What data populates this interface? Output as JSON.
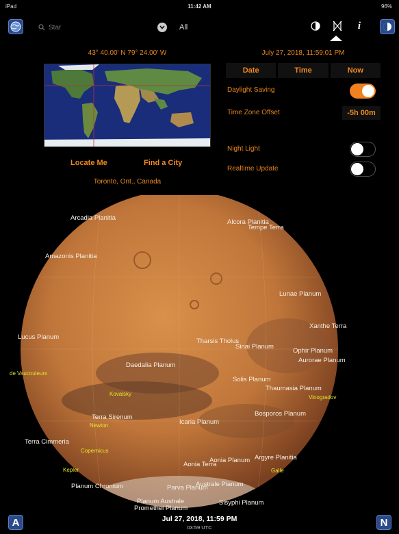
{
  "status": {
    "device": "iPad",
    "time": "11:42 AM",
    "battery": "96%"
  },
  "search": {
    "placeholder": "Star"
  },
  "filter": {
    "label": "All"
  },
  "location": {
    "coordinates": "43° 40.00' N 79° 24.00' W",
    "locate_me": "Locate Me",
    "find_city": "Find a City",
    "place": "Toronto, Ont., Canada"
  },
  "datetime": {
    "current": "July 27, 2018, 11:59:01 PM",
    "seg": [
      "Date",
      "Time",
      "Now"
    ]
  },
  "settings": {
    "daylight_saving": "Daylight Saving",
    "daylight_saving_on": true,
    "tz_offset_label": "Time Zone Offset",
    "tz_offset_value": "-5h 00m",
    "night_light": "Night Light",
    "night_light_on": false,
    "realtime_update": "Realtime Update",
    "realtime_update_on": false
  },
  "mars_labels": [
    {
      "text": "Arcadia Planitia",
      "type": "region"
    },
    {
      "text": "Alcora Planitia",
      "type": "region"
    },
    {
      "text": "Tempe Terra",
      "type": "region"
    },
    {
      "text": "Amazonis Planitia",
      "type": "region"
    },
    {
      "text": "Lunae Planum",
      "type": "region"
    },
    {
      "text": "Xanthe Terra",
      "type": "region"
    },
    {
      "text": "Lucus Planum",
      "type": "region"
    },
    {
      "text": "Tharsis Tholus",
      "type": "region"
    },
    {
      "text": "Sinai Planum",
      "type": "region"
    },
    {
      "text": "Ophir Planum",
      "type": "region"
    },
    {
      "text": "Aurorae Planum",
      "type": "region"
    },
    {
      "text": "de Vaucouleurs",
      "type": "crater"
    },
    {
      "text": "Daedalia Planum",
      "type": "region"
    },
    {
      "text": "Solis Planum",
      "type": "region"
    },
    {
      "text": "Thaumasia Planum",
      "type": "region"
    },
    {
      "text": "Vinogradov",
      "type": "crater"
    },
    {
      "text": "Kovalsky",
      "type": "crater"
    },
    {
      "text": "Terra Sirenum",
      "type": "region"
    },
    {
      "text": "Icaria Planum",
      "type": "region"
    },
    {
      "text": "Bosporos Planum",
      "type": "region"
    },
    {
      "text": "Newton",
      "type": "crater"
    },
    {
      "text": "Terra Cimmeria",
      "type": "region"
    },
    {
      "text": "Copernicus",
      "type": "crater"
    },
    {
      "text": "Aonia Planum",
      "type": "region"
    },
    {
      "text": "Argyre Planitia",
      "type": "region"
    },
    {
      "text": "Aonia Terra",
      "type": "region"
    },
    {
      "text": "Galle",
      "type": "crater"
    },
    {
      "text": "Kepler",
      "type": "crater"
    },
    {
      "text": "Planum Chronium",
      "type": "region"
    },
    {
      "text": "Planum Australe",
      "type": "region"
    },
    {
      "text": "Promethei Planum",
      "type": "region"
    },
    {
      "text": "Parva Planum",
      "type": "region"
    },
    {
      "text": "Australe Planum",
      "type": "region"
    },
    {
      "text": "Sisyphi Planum",
      "type": "region"
    }
  ],
  "bottom": {
    "local": "Jul 27, 2018, 11:59 PM",
    "utc": "03:59 UTC",
    "left_btn": "A",
    "right_btn": "N"
  },
  "colors": {
    "accent": "#f08020",
    "mars": "#c47a3a",
    "button_blue": "#2a4a8a"
  }
}
